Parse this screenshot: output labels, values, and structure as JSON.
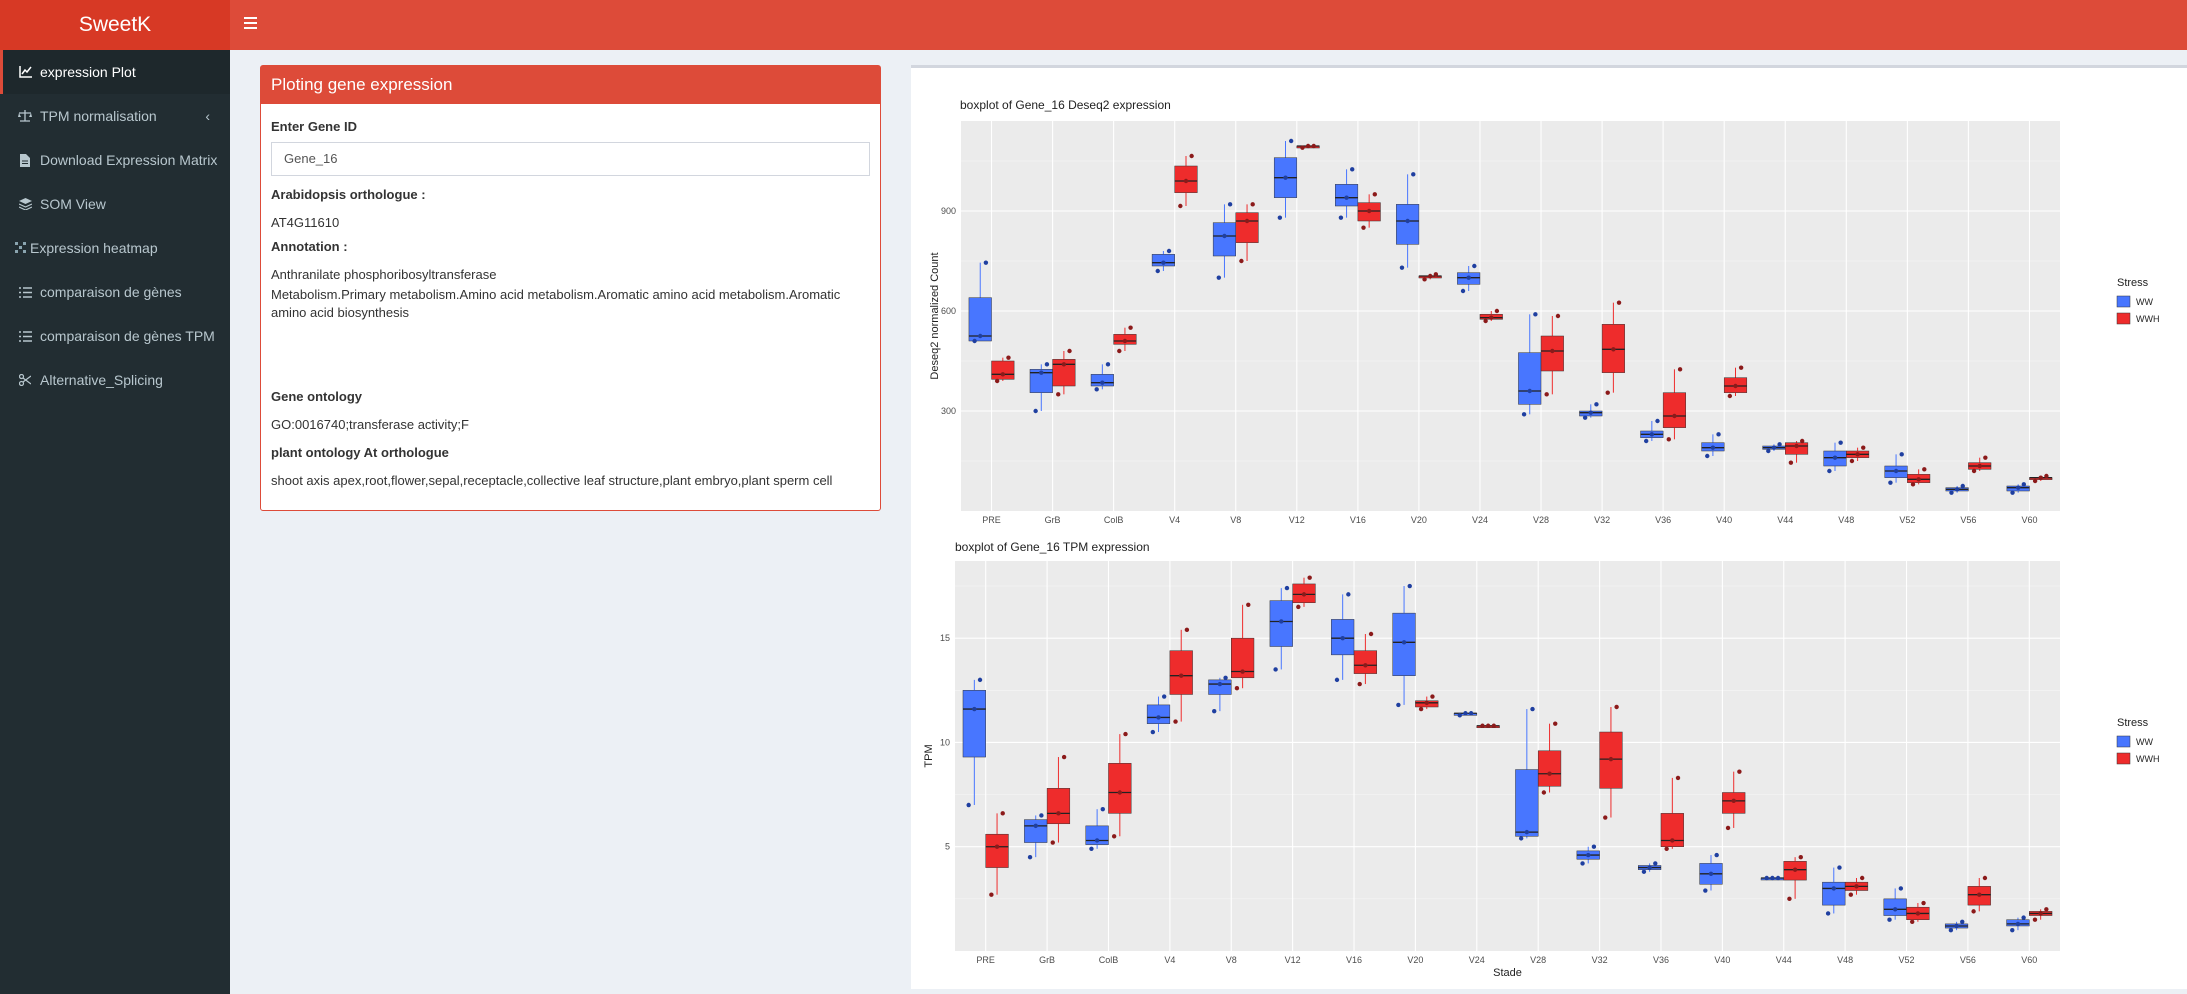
{
  "app": {
    "title": "SweetK"
  },
  "sidebar": {
    "items": [
      {
        "label": "expression Plot",
        "icon": "line-chart-icon"
      },
      {
        "label": "TPM normalisation",
        "icon": "balance-scale-icon"
      },
      {
        "label": "Download Expression Matrix",
        "icon": "file-icon"
      },
      {
        "label": "SOM View",
        "icon": "layers-icon"
      },
      {
        "label": "Expression heatmap",
        "icon": "heatmap-icon"
      },
      {
        "label": "comparaison de gènes",
        "icon": "list-icon"
      },
      {
        "label": "comparaison de gènes TPM",
        "icon": "list-icon"
      },
      {
        "label": "Alternative_Splicing",
        "icon": "scissors-icon"
      }
    ]
  },
  "panel": {
    "title": "Ploting gene expression",
    "gene_label": "Enter Gene ID",
    "gene_value": "Gene_16",
    "ortho_label": "Arabidopsis orthologue :",
    "ortho_value": "AT4G11610",
    "annot_label": "Annotation :",
    "annot_line1": "Anthranilate phosphoribosyltransferase",
    "annot_line2": "Metabolism.Primary metabolism.Amino acid metabolism.Aromatic amino acid metabolism.Aromatic amino acid biosynthesis",
    "go_label": "Gene ontology",
    "go_value": "GO:0016740;transferase activity;F",
    "po_label": "plant ontology At orthologue",
    "po_value": "shoot axis apex,root,flower,sepal,receptacle,collective leaf structure,plant embryo,plant sperm cell"
  },
  "colors": {
    "WW": "#4876ff",
    "WWH": "#ee2c2c",
    "accent": "#dd4b39"
  },
  "chart_data": [
    {
      "type": "boxplot",
      "title": "boxplot of Gene_16 Deseq2 expression",
      "xlabel": "Stade",
      "ylabel": "Deseq2 normalized Count",
      "yticks": [
        300,
        600,
        900
      ],
      "ylim": [
        0,
        1170
      ],
      "legend_title": "Stress",
      "legend_position": "right",
      "categories": [
        "PRE",
        "GrB",
        "ColB",
        "V4",
        "V8",
        "V12",
        "V16",
        "V20",
        "V24",
        "V28",
        "V32",
        "V36",
        "V40",
        "V44",
        "V48",
        "V52",
        "V56",
        "V60"
      ],
      "series": [
        {
          "name": "WW",
          "boxes": [
            [
              510,
              510,
              525,
              640,
              745
            ],
            [
              300,
              355,
              415,
              425,
              440
            ],
            [
              365,
              375,
              385,
              410,
              440
            ],
            [
              720,
              735,
              745,
              770,
              780
            ],
            [
              700,
              765,
              825,
              865,
              920
            ],
            [
              880,
              940,
              1000,
              1060,
              1110
            ],
            [
              880,
              915,
              940,
              980,
              1025
            ],
            [
              730,
              800,
              870,
              920,
              1010
            ],
            [
              660,
              680,
              700,
              715,
              735
            ],
            [
              290,
              320,
              360,
              475,
              590
            ],
            [
              280,
              285,
              295,
              300,
              320
            ],
            [
              210,
              220,
              230,
              240,
              270
            ],
            [
              165,
              180,
              190,
              205,
              230
            ],
            [
              180,
              185,
              190,
              195,
              200
            ],
            [
              120,
              135,
              160,
              180,
              205
            ],
            [
              85,
              100,
              120,
              135,
              170
            ],
            [
              55,
              60,
              65,
              70,
              75
            ],
            [
              55,
              60,
              70,
              75,
              80
            ]
          ]
        },
        {
          "name": "WWH",
          "boxes": [
            [
              390,
              395,
              410,
              450,
              460
            ],
            [
              350,
              375,
              440,
              455,
              480
            ],
            [
              480,
              500,
              510,
              530,
              550
            ],
            [
              915,
              955,
              990,
              1035,
              1065
            ],
            [
              750,
              805,
              870,
              895,
              920
            ],
            [
              1090,
              1090,
              1095,
              1095,
              1095
            ],
            [
              850,
              870,
              900,
              925,
              950
            ],
            [
              695,
              700,
              705,
              705,
              710
            ],
            [
              570,
              575,
              580,
              590,
              600
            ],
            [
              350,
              420,
              480,
              525,
              585
            ],
            [
              355,
              415,
              485,
              560,
              625
            ],
            [
              215,
              250,
              285,
              355,
              425
            ],
            [
              345,
              355,
              375,
              400,
              430
            ],
            [
              145,
              170,
              195,
              205,
              210
            ],
            [
              150,
              160,
              170,
              180,
              190
            ],
            [
              80,
              85,
              95,
              110,
              125
            ],
            [
              120,
              125,
              135,
              145,
              160
            ],
            [
              90,
              95,
              100,
              100,
              105
            ]
          ]
        }
      ]
    },
    {
      "type": "boxplot",
      "title": "boxplot of Gene_16 TPM expression",
      "xlabel": "Stade",
      "ylabel": "TPM",
      "yticks": [
        5,
        10,
        15
      ],
      "ylim": [
        0,
        18.7
      ],
      "legend_title": "Stress",
      "legend_position": "right",
      "categories": [
        "PRE",
        "GrB",
        "ColB",
        "V4",
        "V8",
        "V12",
        "V16",
        "V20",
        "V24",
        "V28",
        "V32",
        "V36",
        "V40",
        "V44",
        "V48",
        "V52",
        "V56",
        "V60"
      ],
      "series": [
        {
          "name": "WW",
          "boxes": [
            [
              7.0,
              9.3,
              11.6,
              12.5,
              13.0
            ],
            [
              4.5,
              5.2,
              6.0,
              6.3,
              6.5
            ],
            [
              4.9,
              5.1,
              5.3,
              6.0,
              6.8
            ],
            [
              10.5,
              10.9,
              11.2,
              11.8,
              12.2
            ],
            [
              11.5,
              12.3,
              12.8,
              13.0,
              13.1
            ],
            [
              13.5,
              14.6,
              15.8,
              16.8,
              17.4
            ],
            [
              13.0,
              14.2,
              15.0,
              15.9,
              17.1
            ],
            [
              11.8,
              13.2,
              14.8,
              16.2,
              17.5
            ],
            [
              11.3,
              11.3,
              11.4,
              11.4,
              11.4
            ],
            [
              5.4,
              5.5,
              5.7,
              8.7,
              11.6
            ],
            [
              4.2,
              4.4,
              4.6,
              4.8,
              5.0
            ],
            [
              3.8,
              3.9,
              4.0,
              4.1,
              4.2
            ],
            [
              2.9,
              3.2,
              3.7,
              4.2,
              4.6
            ],
            [
              3.5,
              3.5,
              3.5,
              3.5,
              3.5
            ],
            [
              1.8,
              2.2,
              3.0,
              3.3,
              4.0
            ],
            [
              1.5,
              1.7,
              2.0,
              2.5,
              3.0
            ],
            [
              1.0,
              1.1,
              1.2,
              1.3,
              1.4
            ],
            [
              1.0,
              1.2,
              1.3,
              1.5,
              1.6
            ]
          ]
        },
        {
          "name": "WWH",
          "boxes": [
            [
              2.7,
              4.0,
              5.0,
              5.6,
              6.6
            ],
            [
              5.2,
              6.1,
              6.6,
              7.8,
              9.3
            ],
            [
              5.5,
              6.6,
              7.6,
              9.0,
              10.4
            ],
            [
              11.0,
              12.3,
              13.2,
              14.4,
              15.4
            ],
            [
              12.6,
              13.1,
              13.4,
              15.0,
              16.6
            ],
            [
              16.5,
              16.7,
              17.1,
              17.6,
              17.9
            ],
            [
              12.8,
              13.3,
              13.7,
              14.4,
              15.2
            ],
            [
              11.6,
              11.7,
              11.9,
              12.0,
              12.2
            ],
            [
              10.8,
              10.8,
              10.8,
              10.8,
              10.8
            ],
            [
              7.6,
              7.9,
              8.5,
              9.6,
              10.9
            ],
            [
              6.4,
              7.8,
              9.2,
              10.5,
              11.7
            ],
            [
              4.9,
              5.0,
              5.3,
              6.6,
              8.3
            ],
            [
              5.9,
              6.6,
              7.2,
              7.6,
              8.6
            ],
            [
              2.5,
              3.4,
              3.9,
              4.3,
              4.5
            ],
            [
              2.7,
              2.9,
              3.1,
              3.3,
              3.5
            ],
            [
              1.4,
              1.5,
              1.8,
              2.1,
              2.3
            ],
            [
              1.9,
              2.2,
              2.7,
              3.1,
              3.5
            ],
            [
              1.5,
              1.7,
              1.8,
              1.9,
              2.0
            ]
          ]
        }
      ]
    }
  ]
}
